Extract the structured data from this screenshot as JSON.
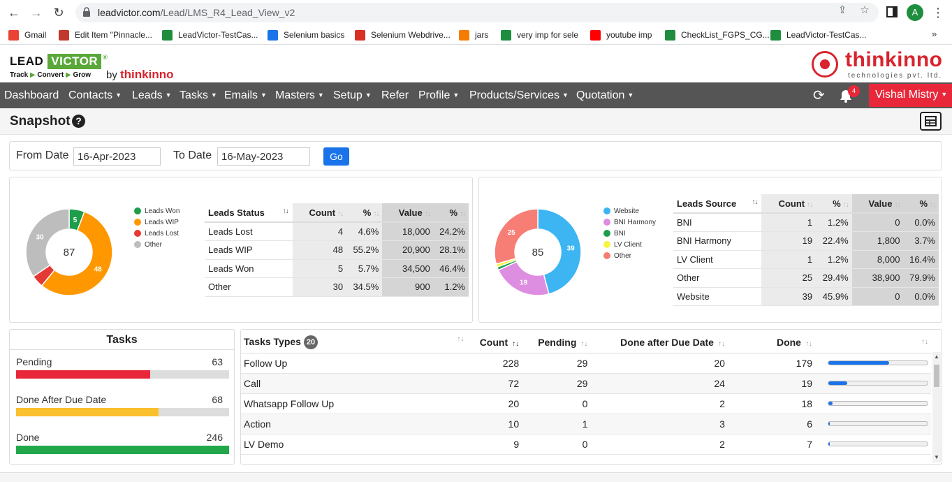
{
  "browser": {
    "url_host": "leadvictor.com",
    "url_path": "/Lead/LMS_R4_Lead_View_v2",
    "avatar_letter": "A"
  },
  "bookmarks": [
    {
      "label": "Gmail",
      "icon": "gmail-icon",
      "color": "#ea4335"
    },
    {
      "label": "Edit Item \"Pinnacle...",
      "icon": "edit-icon",
      "color": "#c0392b"
    },
    {
      "label": "LeadVictor-TestCas...",
      "icon": "sheets-icon",
      "color": "#1e8e3e"
    },
    {
      "label": "Selenium basics",
      "icon": "chrome-icon",
      "color": "#1a73e8"
    },
    {
      "label": "Selenium Webdrive...",
      "icon": "triangle-icon",
      "color": "#d93025"
    },
    {
      "label": "jars",
      "icon": "blogger-icon",
      "color": "#f57c00"
    },
    {
      "label": "very imp for sele",
      "icon": "s-icon",
      "color": "#1e8e3e"
    },
    {
      "label": "youtube imp",
      "icon": "youtube-icon",
      "color": "#ff0000"
    },
    {
      "label": "CheckList_FGPS_CG...",
      "icon": "sheets-icon",
      "color": "#1e8e3e"
    },
    {
      "label": "LeadVictor-TestCas...",
      "icon": "sheets-icon",
      "color": "#1e8e3e"
    }
  ],
  "brand": {
    "lead": "LEAD",
    "victor": "VICTOR",
    "reg": "®",
    "tagline_1": "Track",
    "tagline_2": "Convert",
    "tagline_3": "Grow",
    "by": "by",
    "thinkinno": "thinkinno",
    "right_name": "thinkinno",
    "right_sub": "technologies pvt. ltd."
  },
  "nav": {
    "items": [
      {
        "label": "Dashboard",
        "caret": false
      },
      {
        "label": "Contacts",
        "caret": true
      },
      {
        "label": "Leads",
        "caret": true
      },
      {
        "label": "Tasks",
        "caret": true
      },
      {
        "label": "Emails",
        "caret": true
      },
      {
        "label": "Masters",
        "caret": true
      },
      {
        "label": "Setup",
        "caret": true
      },
      {
        "label": "Refer",
        "caret": false
      },
      {
        "label": "Profile",
        "caret": true
      },
      {
        "label": "Products/Services",
        "caret": true
      },
      {
        "label": "Quotation",
        "caret": true
      }
    ],
    "notifications": "4",
    "user": "Vishal Mistry"
  },
  "page": {
    "title": "Snapshot"
  },
  "filter": {
    "from_label": "From Date",
    "from_value": "16-Apr-2023",
    "to_label": "To Date",
    "to_value": "16-May-2023",
    "go": "Go"
  },
  "status_chart": {
    "center": "87",
    "legend": [
      {
        "name": "Leads Won",
        "color": "#1e9e4a"
      },
      {
        "name": "Leads WIP",
        "color": "#ff9800"
      },
      {
        "name": "Leads Lost",
        "color": "#e53935"
      },
      {
        "name": "Other",
        "color": "#bdbdbd"
      }
    ],
    "slices": [
      {
        "name": "Leads Won",
        "value": 5,
        "color": "#1e9e4a",
        "label": "5"
      },
      {
        "name": "Leads WIP",
        "value": 48,
        "color": "#ff9800",
        "label": "48"
      },
      {
        "name": "Leads Lost",
        "value": 4,
        "color": "#e53935",
        "label": ""
      },
      {
        "name": "Other",
        "value": 30,
        "color": "#bdbdbd",
        "label": "30"
      }
    ]
  },
  "status_table": {
    "headers": [
      "Leads Status",
      "Count",
      "%",
      "Value",
      "%"
    ],
    "rows": [
      [
        "Leads Lost",
        "4",
        "4.6%",
        "18,000",
        "24.2%"
      ],
      [
        "Leads WIP",
        "48",
        "55.2%",
        "20,900",
        "28.1%"
      ],
      [
        "Leads Won",
        "5",
        "5.7%",
        "34,500",
        "46.4%"
      ],
      [
        "Other",
        "30",
        "34.5%",
        "900",
        "1.2%"
      ]
    ]
  },
  "source_chart": {
    "center": "85",
    "legend": [
      {
        "name": "Website",
        "color": "#3db5f2"
      },
      {
        "name": "BNI Harmony",
        "color": "#dd8ee0"
      },
      {
        "name": "BNI",
        "color": "#1e9e4a"
      },
      {
        "name": "LV Client",
        "color": "#f5f542"
      },
      {
        "name": "Other",
        "color": "#f77e74"
      }
    ],
    "slices": [
      {
        "name": "Website",
        "value": 39,
        "color": "#3db5f2",
        "label": "39"
      },
      {
        "name": "BNI Harmony",
        "value": 19,
        "color": "#dd8ee0",
        "label": "19"
      },
      {
        "name": "BNI",
        "value": 1,
        "color": "#1e9e4a",
        "label": ""
      },
      {
        "name": "LV Client",
        "value": 1,
        "color": "#f5f542",
        "label": ""
      },
      {
        "name": "Other",
        "value": 25,
        "color": "#f77e74",
        "label": "25"
      }
    ]
  },
  "source_table": {
    "headers": [
      "Leads Source",
      "Count",
      "%",
      "Value",
      "%"
    ],
    "rows": [
      [
        "BNI",
        "1",
        "1.2%",
        "0",
        "0.0%"
      ],
      [
        "BNI Harmony",
        "19",
        "22.4%",
        "1,800",
        "3.7%"
      ],
      [
        "LV Client",
        "1",
        "1.2%",
        "8,000",
        "16.4%"
      ],
      [
        "Other",
        "25",
        "29.4%",
        "38,900",
        "79.9%"
      ],
      [
        "Website",
        "39",
        "45.9%",
        "0",
        "0.0%"
      ]
    ]
  },
  "tasks": {
    "title": "Tasks",
    "items": [
      {
        "label": "Pending",
        "value": "63",
        "fraction": 0.63,
        "color": "#e8283a"
      },
      {
        "label": "Done After Due Date",
        "value": "68",
        "fraction": 0.67,
        "color": "#fbc02d"
      },
      {
        "label": "Done",
        "value": "246",
        "fraction": 1.0,
        "color": "#22a84a"
      }
    ]
  },
  "task_types": {
    "title": "Tasks Types",
    "badge": "20",
    "headers": [
      "Count",
      "Pending",
      "Done after Due Date",
      "Done"
    ],
    "rows": [
      {
        "name": "Follow Up",
        "count": "228",
        "pending": "29",
        "done_late": "20",
        "done": "179",
        "fraction": 0.61
      },
      {
        "name": "Call",
        "count": "72",
        "pending": "29",
        "done_late": "24",
        "done": "19",
        "fraction": 0.19
      },
      {
        "name": "Whatsapp Follow Up",
        "count": "20",
        "pending": "0",
        "done_late": "2",
        "done": "18",
        "fraction": 0.04
      },
      {
        "name": "Action",
        "count": "10",
        "pending": "1",
        "done_late": "3",
        "done": "6",
        "fraction": 0.015
      },
      {
        "name": "LV Demo",
        "count": "9",
        "pending": "0",
        "done_late": "2",
        "done": "7",
        "fraction": 0.015
      }
    ]
  }
}
